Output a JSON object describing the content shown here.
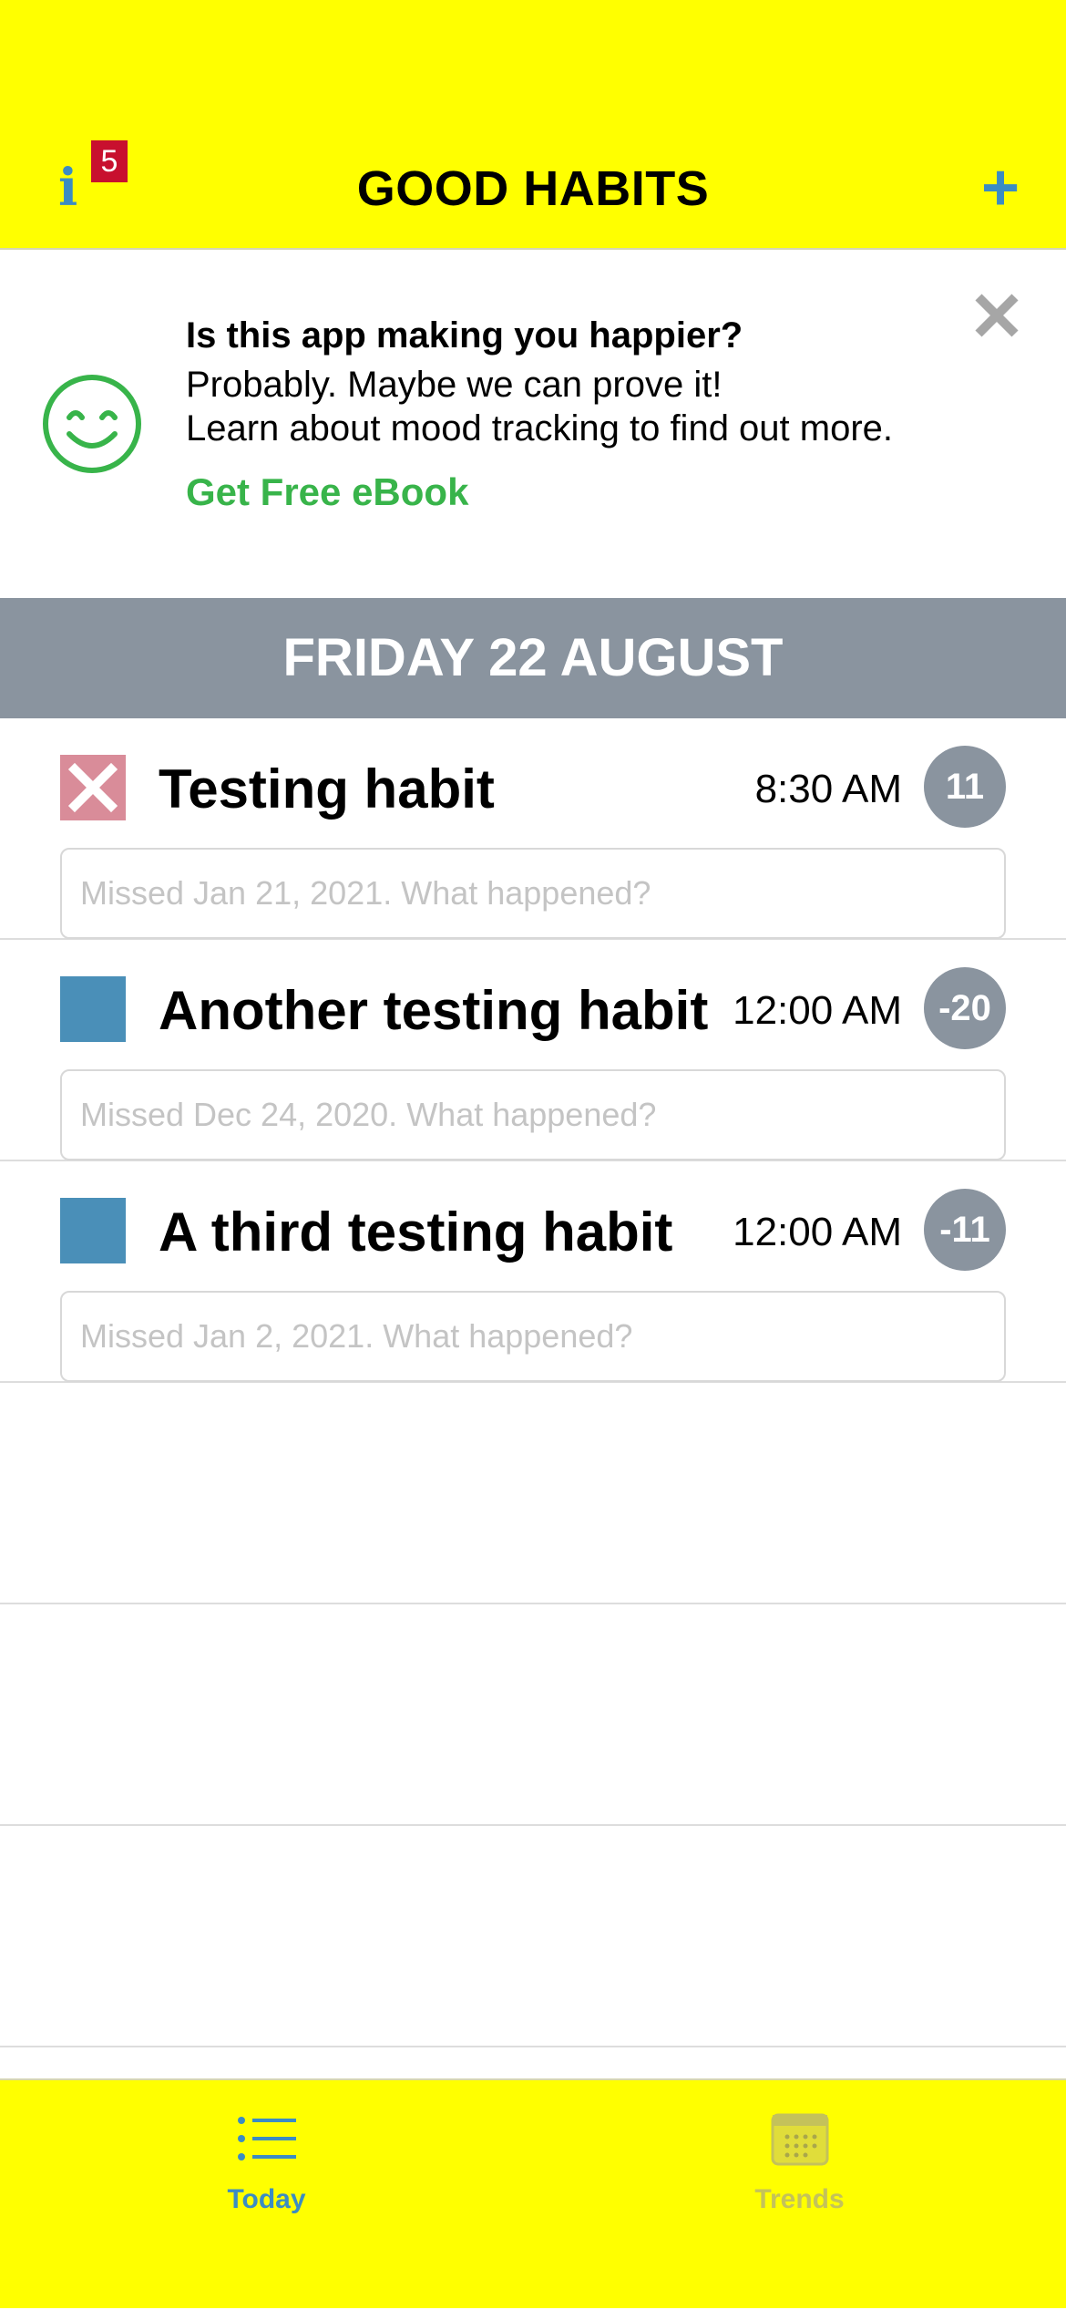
{
  "header": {
    "title": "GOOD HABITS",
    "info_icon": "i",
    "info_badge": "5",
    "add_icon": "+"
  },
  "promo": {
    "title": "Is this app making you happier?",
    "line1": "Probably. Maybe we can prove it!",
    "line2": "Learn about mood tracking to find out more.",
    "link": "Get Free eBook",
    "icon": "smiley-icon",
    "close_icon": "close-icon"
  },
  "date_band": {
    "label": "FRIDAY 22 AUGUST"
  },
  "habits": [
    {
      "name": "Testing habit",
      "time": "8:30 AM",
      "streak": "11",
      "status": "missed",
      "placeholder": "Missed Jan 21, 2021. What happened?",
      "check_color": "#d98c99"
    },
    {
      "name": "Another testing habit",
      "time": "12:00 AM",
      "streak": "-20",
      "status": "pending",
      "placeholder": "Missed Dec 24, 2020. What happened?",
      "check_color": "#4a8fb8"
    },
    {
      "name": "A third testing habit",
      "time": "12:00 AM",
      "streak": "-11",
      "status": "pending",
      "placeholder": "Missed Jan 2, 2021. What happened?",
      "check_color": "#4a8fb8"
    }
  ],
  "tabs": [
    {
      "label": "Today",
      "icon": "list-icon",
      "active": true
    },
    {
      "label": "Trends",
      "icon": "calendar-icon",
      "active": false
    }
  ],
  "colors": {
    "header_bg": "#ffff00",
    "accent": "#3b8cc3",
    "badge": "#c8102e",
    "link": "#38b44a",
    "date_band": "#8a949f"
  }
}
